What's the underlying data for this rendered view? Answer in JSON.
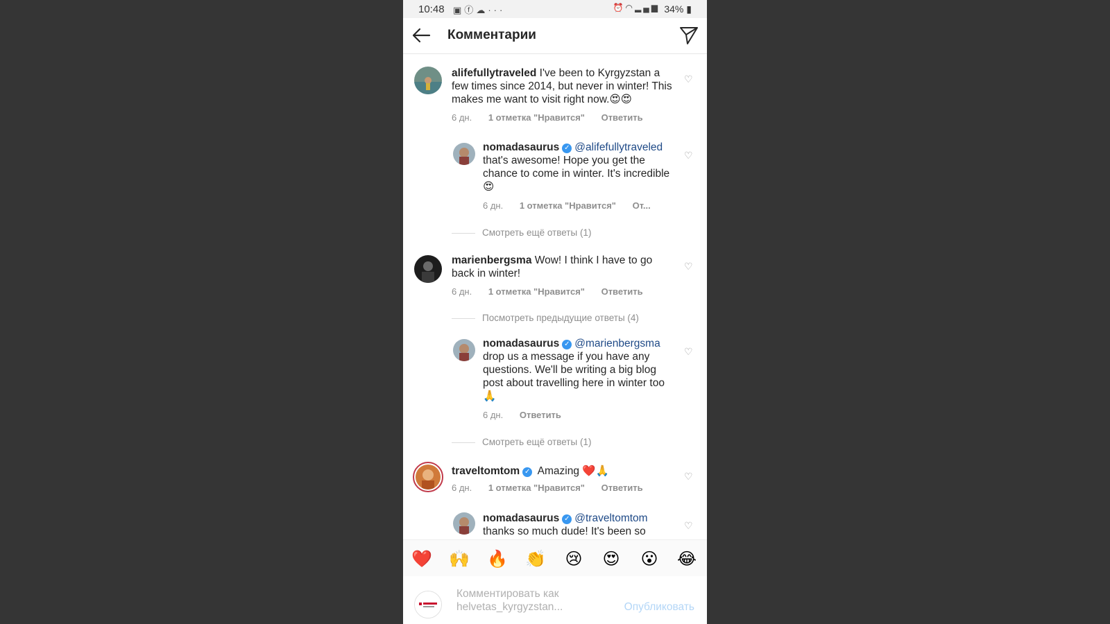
{
  "status_bar": {
    "time": "10:48",
    "left_icons": [
      "image-icon",
      "facebook-icon",
      "weather-icon",
      "more-icon"
    ],
    "right_icons": [
      "alarm-icon",
      "wifi-icon",
      "signal-icon"
    ],
    "battery": "34%"
  },
  "header": {
    "title": "Комментарии",
    "back_icon": "arrow-left-icon",
    "send_icon": "paper-plane-icon"
  },
  "comments": [
    {
      "username": "alifefullytraveled",
      "verified": false,
      "text": "I've been to Kyrgyzstan a few times since 2014, but never in winter! This makes me want to visit right now.😍😍",
      "age": "6 дн.",
      "likes": "1 отметка \"Нравится\"",
      "reply": "Ответить",
      "avatar_color": "#6f8f86"
    },
    {
      "username": "nomadasaurus",
      "verified": true,
      "mention": "@alifefullytraveled",
      "text": "that's awesome! Hope you get the chance to come in winter. It's incredible 😍",
      "age": "6 дн.",
      "likes": "1 отметка \"Нравится\"",
      "reply": "От..."
    },
    {
      "username": "marienbergsma",
      "verified": false,
      "text": "Wow! I think I have to go back in winter!",
      "age": "6 дн.",
      "likes": "1 отметка \"Нравится\"",
      "reply": "Ответить"
    },
    {
      "username": "nomadasaurus",
      "verified": true,
      "mention": "@marienbergsma",
      "text": "drop us a message if you have any questions. We'll be writing a big blog post about travelling here in winter too 🙏",
      "age": "6 дн.",
      "reply": "Ответить"
    },
    {
      "username": "traveltomtom",
      "verified": true,
      "text": "Amazing ❤️🙏",
      "age": "6 дн.",
      "likes": "1 отметка \"Нравится\"",
      "reply": "Ответить"
    },
    {
      "username": "nomadasaurus",
      "verified": true,
      "mention": "@traveltomtom",
      "text": "thanks so much dude! It's been so"
    }
  ],
  "more_replies": {
    "first": "Смотреть ещё ответы (1)",
    "previous": "Посмотреть предыдущие ответы (4)",
    "second": "Смотреть ещё ответы (1)"
  },
  "emoji_bar": [
    "❤️",
    "🙌",
    "🔥",
    "👏",
    "😢",
    "😍",
    "😮",
    "😂"
  ],
  "composer": {
    "placeholder": "Комментировать как helvetas_kyrgyzstan...",
    "publish": "Опубликовать"
  },
  "colors": {
    "background": "#353535",
    "accent": "#3897f0",
    "mention": "#1f4a87",
    "muted": "#8e8e8e"
  }
}
